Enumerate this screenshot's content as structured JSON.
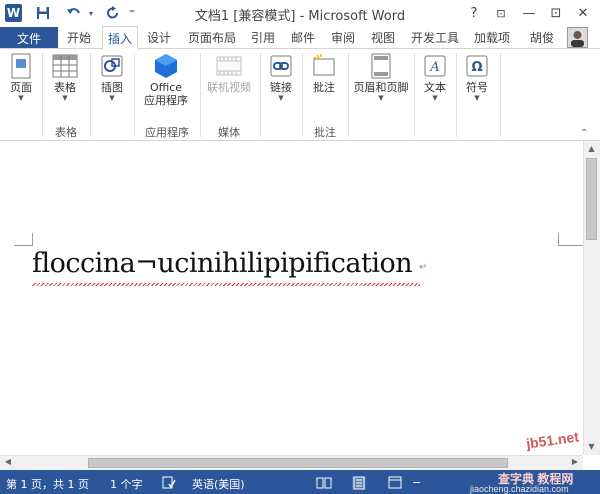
{
  "titlebar": {
    "app_title": "文档1 [兼容模式] - Microsoft Word",
    "help": "?",
    "minimize": "—",
    "restore": "⊡",
    "close": "✕"
  },
  "tabs": {
    "file": "文件",
    "items": [
      "开始",
      "插入",
      "设计",
      "页面布局",
      "引用",
      "邮件",
      "审阅",
      "视图",
      "开发工具",
      "加载项"
    ],
    "active": "插入",
    "user": "胡俊"
  },
  "ribbon": {
    "page": "页面",
    "table": "表格",
    "illustrations": "插图",
    "office_line1": "Office",
    "office_line2": "应用程序",
    "online_video": "联机视频",
    "link": "链接",
    "comment": "批注",
    "header_footer": "页眉和页脚",
    "text": "文本",
    "symbol": "符号",
    "groups": {
      "tables": "表格",
      "apps": "应用程序",
      "media": "媒体",
      "comments": "批注"
    }
  },
  "document": {
    "text": "floccina¬ucinihilipipification"
  },
  "status": {
    "page": "第 1 页，共 1 页",
    "words": "1 个字",
    "language": "英语(美国)"
  },
  "watermark": {
    "line1": "查字典 教程网",
    "line2": "jiaocheng.chazidian.com",
    "site": "jb51.net"
  },
  "colors": {
    "accent": "#2b579a",
    "squiggle": "#e03030"
  }
}
